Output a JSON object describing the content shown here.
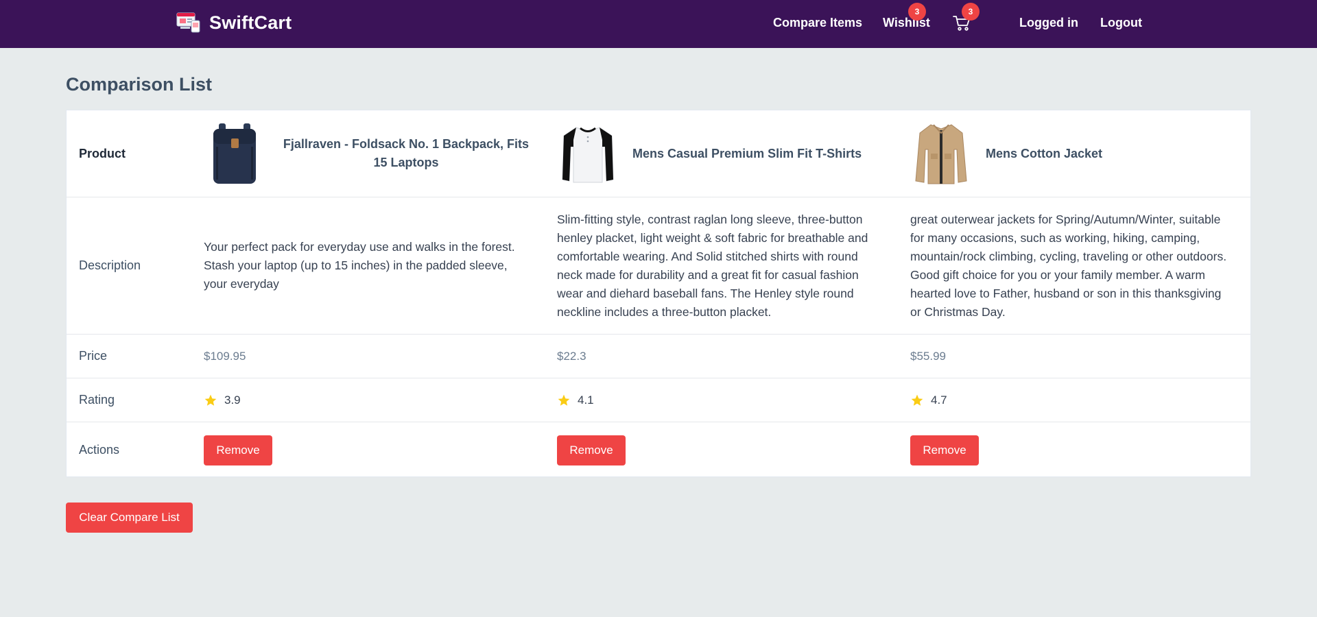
{
  "header": {
    "brand": "SwiftCart",
    "nav": {
      "compare": "Compare Items",
      "wishlist": "Wishlist",
      "wishlist_count": "3",
      "cart_count": "3",
      "logged_in": "Logged in",
      "logout": "Logout"
    }
  },
  "page": {
    "title": "Comparison List",
    "row_labels": {
      "product": "Product",
      "description": "Description",
      "price": "Price",
      "rating": "Rating",
      "actions": "Actions"
    },
    "products": [
      {
        "name": "Fjallraven - Foldsack No. 1 Backpack, Fits 15 Laptops",
        "description": "Your perfect pack for everyday use and walks in the forest. Stash your laptop (up to 15 inches) in the padded sleeve, your everyday",
        "price": "$109.95",
        "rating": "3.9",
        "image_icon": "backpack-image",
        "remove_label": "Remove"
      },
      {
        "name": "Mens Casual Premium Slim Fit T-Shirts",
        "description": "Slim-fitting style, contrast raglan long sleeve, three-button henley placket, light weight & soft fabric for breathable and comfortable wearing. And Solid stitched shirts with round neck made for durability and a great fit for casual fashion wear and diehard baseball fans. The Henley style round neckline includes a three-button placket.",
        "price": "$22.3",
        "rating": "4.1",
        "image_icon": "tshirt-image",
        "remove_label": "Remove"
      },
      {
        "name": "Mens Cotton Jacket",
        "description": "great outerwear jackets for Spring/Autumn/Winter, suitable for many occasions, such as working, hiking, camping, mountain/rock climbing, cycling, traveling or other outdoors. Good gift choice for you or your family member. A warm hearted love to Father, husband or son in this thanksgiving or Christmas Day.",
        "price": "$55.99",
        "rating": "4.7",
        "image_icon": "jacket-image",
        "remove_label": "Remove"
      }
    ],
    "clear_label": "Clear Compare List"
  },
  "colors": {
    "navbar": "#3b1358",
    "danger": "#ef4444",
    "star": "#facc15",
    "background": "#e7ebec"
  }
}
